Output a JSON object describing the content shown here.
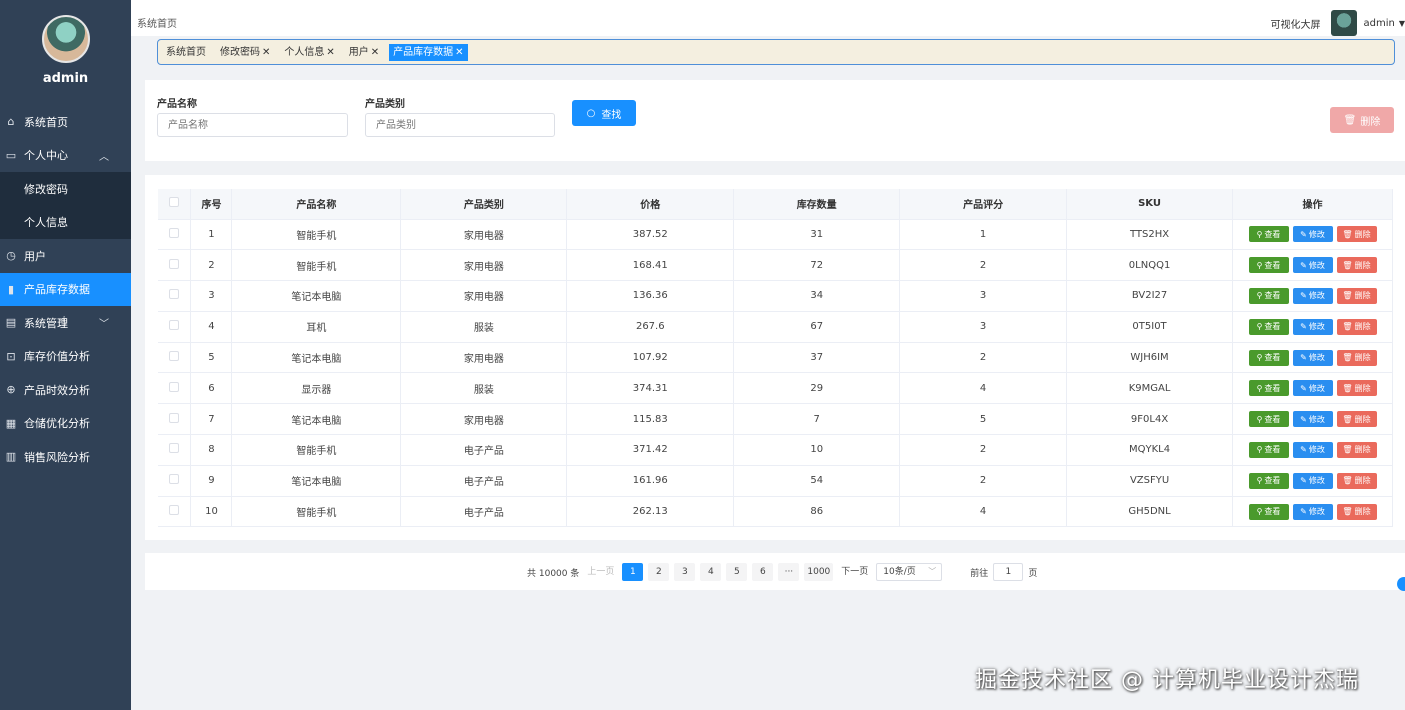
{
  "sidebar": {
    "username": "admin",
    "items": [
      {
        "label": "系统首页",
        "icon": "home-icon",
        "glyph": "⌂"
      },
      {
        "label": "个人中心",
        "icon": "calendar-icon",
        "glyph": "▭",
        "arrow": "︿"
      },
      {
        "label": "修改密码",
        "sub": true
      },
      {
        "label": "个人信息",
        "sub": true
      },
      {
        "label": "用户",
        "icon": "clock-icon",
        "glyph": "◷"
      },
      {
        "label": "产品库存数据",
        "icon": "bar-chart-icon",
        "glyph": "▮",
        "active": true
      },
      {
        "label": "系统管理",
        "icon": "clipboard-icon",
        "glyph": "▤",
        "arrow": "﹀"
      },
      {
        "label": "库存价值分析",
        "icon": "crop-icon",
        "glyph": "⊡"
      },
      {
        "label": "产品时效分析",
        "icon": "globe-icon",
        "glyph": "⊕"
      },
      {
        "label": "仓储优化分析",
        "icon": "list-icon",
        "glyph": "▦"
      },
      {
        "label": "销售风险分析",
        "icon": "grid-icon",
        "glyph": "▥"
      }
    ]
  },
  "header": {
    "breadcrumb": "系统首页",
    "bigscreen": "可视化大屏",
    "user": "admin"
  },
  "tags": [
    {
      "label": "系统首页",
      "closable": false
    },
    {
      "label": "修改密码",
      "closable": true
    },
    {
      "label": "个人信息",
      "closable": true
    },
    {
      "label": "用户",
      "closable": true
    },
    {
      "label": "产品库存数据",
      "closable": true,
      "active": true
    }
  ],
  "search": {
    "name_label": "产品名称",
    "name_placeholder": "产品名称",
    "category_label": "产品类别",
    "category_placeholder": "产品类别",
    "search_button": "查找",
    "delete_button": "删除"
  },
  "table": {
    "headers": [
      "序号",
      "产品名称",
      "产品类别",
      "价格",
      "库存数量",
      "产品评分",
      "SKU",
      "操作"
    ],
    "rows": [
      [
        "1",
        "智能手机",
        "家用电器",
        "387.52",
        "31",
        "1",
        "TTS2HX"
      ],
      [
        "2",
        "智能手机",
        "家用电器",
        "168.41",
        "72",
        "2",
        "0LNQQ1"
      ],
      [
        "3",
        "笔记本电脑",
        "家用电器",
        "136.36",
        "34",
        "3",
        "BV2I27"
      ],
      [
        "4",
        "耳机",
        "服装",
        "267.6",
        "67",
        "3",
        "0T5I0T"
      ],
      [
        "5",
        "笔记本电脑",
        "家用电器",
        "107.92",
        "37",
        "2",
        "WJH6IM"
      ],
      [
        "6",
        "显示器",
        "服装",
        "374.31",
        "29",
        "4",
        "K9MGAL"
      ],
      [
        "7",
        "笔记本电脑",
        "家用电器",
        "115.83",
        "7",
        "5",
        "9F0L4X"
      ],
      [
        "8",
        "智能手机",
        "电子产品",
        "371.42",
        "10",
        "2",
        "MQYKL4"
      ],
      [
        "9",
        "笔记本电脑",
        "电子产品",
        "161.96",
        "54",
        "2",
        "VZSFYU"
      ],
      [
        "10",
        "智能手机",
        "电子产品",
        "262.13",
        "86",
        "4",
        "GH5DNL"
      ]
    ],
    "actions": {
      "view": "查看",
      "edit": "修改",
      "delete": "删除"
    }
  },
  "pagination": {
    "total": "共 10000 条",
    "prev": "上一页",
    "pages": [
      "1",
      "2",
      "3",
      "4",
      "5",
      "6",
      "···",
      "1000"
    ],
    "current": "1",
    "next": "下一页",
    "page_size": "10条/页",
    "goto_label": "前往",
    "goto_value": "1",
    "goto_suffix": "页"
  },
  "watermark": "掘金技术社区 @ 计算机毕业设计杰瑞",
  "colors": {
    "sidebar_bg": "#304156",
    "accent": "#1890ff",
    "view": "#4a9a2c",
    "edit": "#2a8ef0",
    "delete": "#ea6a5c"
  }
}
